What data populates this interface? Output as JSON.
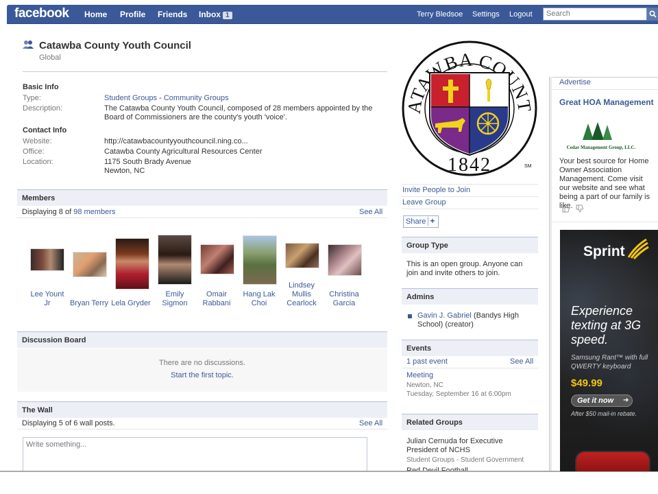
{
  "topnav": {
    "logo": "facebook",
    "home": "Home",
    "profile": "Profile",
    "friends": "Friends",
    "inbox": "Inbox",
    "inbox_count": "1",
    "user": "Terry Bledsoe",
    "settings": "Settings",
    "logout": "Logout",
    "search_placeholder": "Search"
  },
  "group": {
    "name": "Catawba County Youth Council",
    "scope": "Global"
  },
  "basic_info": {
    "heading": "Basic Info",
    "type_label": "Type:",
    "type_a": "Student Groups",
    "type_sep": " - ",
    "type_b": "Community Groups",
    "description_label": "Description:",
    "description": "The Catawba County Youth Council, composed of 28 members appointed by the Board of Commissioners are the county's youth 'voice'."
  },
  "contact_info": {
    "heading": "Contact Info",
    "website_label": "Website:",
    "website": "http://catawbacountyyouthcouncil.ning.co...",
    "office_label": "Office:",
    "office": "Catawba County Agricultural Resources Center",
    "location_label": "Location:",
    "address": "1175 South Brady Avenue",
    "city": "Newton, NC"
  },
  "members": {
    "heading": "Members",
    "displaying_prefix": "Displaying 8 of",
    "count_link": "98 members",
    "see_all": "See All",
    "list": [
      {
        "name_l1": "Lee Yount",
        "name_l2": "Jr"
      },
      {
        "name_l1": "Bryan Terry",
        "name_l2": ""
      },
      {
        "name_l1": "Lela Gryder",
        "name_l2": ""
      },
      {
        "name_l1": "Emily",
        "name_l2": "Sigmon"
      },
      {
        "name_l1": "Omair",
        "name_l2": "Rabbani"
      },
      {
        "name_l1": "Hang Lak",
        "name_l2": "Choi"
      },
      {
        "name_l1": "Lindsey",
        "name_l2": "Mullis",
        "name_l3": "Cearlock"
      },
      {
        "name_l1": "Christina",
        "name_l2": "Garcia"
      }
    ]
  },
  "discussion": {
    "heading": "Discussion Board",
    "empty": "There are no discussions.",
    "start": "Start the first topic."
  },
  "wall": {
    "heading": "The Wall",
    "displaying": "Displaying 5 of 6 wall posts.",
    "see_all": "See All",
    "placeholder": "Write something..."
  },
  "seal": {
    "top_text": "CATAWBA COUNTY",
    "year": "1842",
    "mark": "SM"
  },
  "actions": {
    "invite": "Invite People to Join",
    "leave": "Leave Group",
    "share": "Share",
    "share_plus": "+"
  },
  "group_type": {
    "heading": "Group Type",
    "text": "This is an open group. Anyone can join and invite others to join."
  },
  "admins": {
    "heading": "Admins",
    "admin_name": "Gavin J. Gabriel",
    "admin_detail": "(Bandys High School) (creator)"
  },
  "events": {
    "heading": "Events",
    "past": "1 past event",
    "see_all": "See All",
    "event_name": "Meeting",
    "event_place": "Newton, NC",
    "event_time": "Tuesday, September 16 at 6:00pm"
  },
  "related": {
    "heading": "Related Groups",
    "item1": "Julian Cernuda for Executive President of NCHS",
    "item1_cat": "Student Groups - Student Government",
    "item2": "Red Devil Football"
  },
  "ads": {
    "advertise": "Advertise",
    "hoa_title": "Great HOA Management",
    "hoa_company": "Cedar Management Group, LLC.",
    "hoa_body": "Your best source for Home Owner Association Management. Come visit our website and see what being a part of our family is like.",
    "sprint_brand": "Sprint",
    "sprint_headline": "Experience texting at 3G speed.",
    "sprint_product": "Samsung Rant™ with full QWERTY keyboard",
    "sprint_price": "$49.99",
    "sprint_cta": "Get it now",
    "sprint_rebate": "After $50 mail-in rebate."
  },
  "colors": {
    "facebook_blue": "#3b5998",
    "header_bg": "#eceff5"
  }
}
